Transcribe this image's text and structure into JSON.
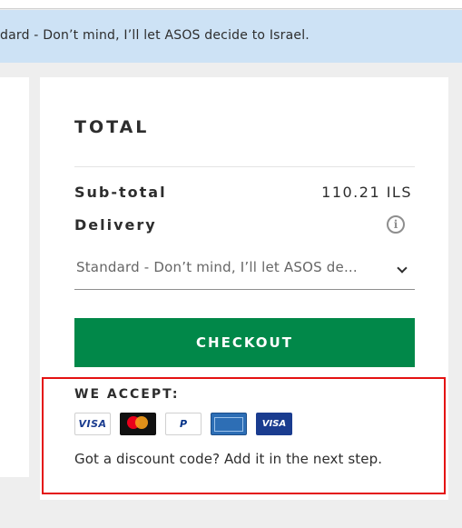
{
  "notice": {
    "text": "dard - Don’t mind, I’ll let ASOS decide to Israel."
  },
  "total": {
    "title": "TOTAL",
    "subtotal_label": "Sub-total",
    "subtotal_value": "110.21 ILS",
    "delivery_label": "Delivery",
    "delivery_info_icon": "info-icon",
    "delivery_select_value": "Standard - Don’t mind, I’ll let ASOS de...",
    "checkout_label": "CHECKOUT"
  },
  "payment": {
    "title": "WE ACCEPT:",
    "cards": [
      {
        "name": "visa",
        "label": "VISA"
      },
      {
        "name": "mastercard",
        "label": "mastercard"
      },
      {
        "name": "paypal",
        "label": "PayPal"
      },
      {
        "name": "american-express",
        "label": "AMERICAN EXPRESS"
      },
      {
        "name": "visa-electron",
        "label": "VISA"
      }
    ],
    "discount_text": "Got a discount code? Add it in the next step."
  },
  "colors": {
    "checkout_green": "#018849",
    "notice_blue": "#cde2f5",
    "highlight_red": "#e41212"
  }
}
